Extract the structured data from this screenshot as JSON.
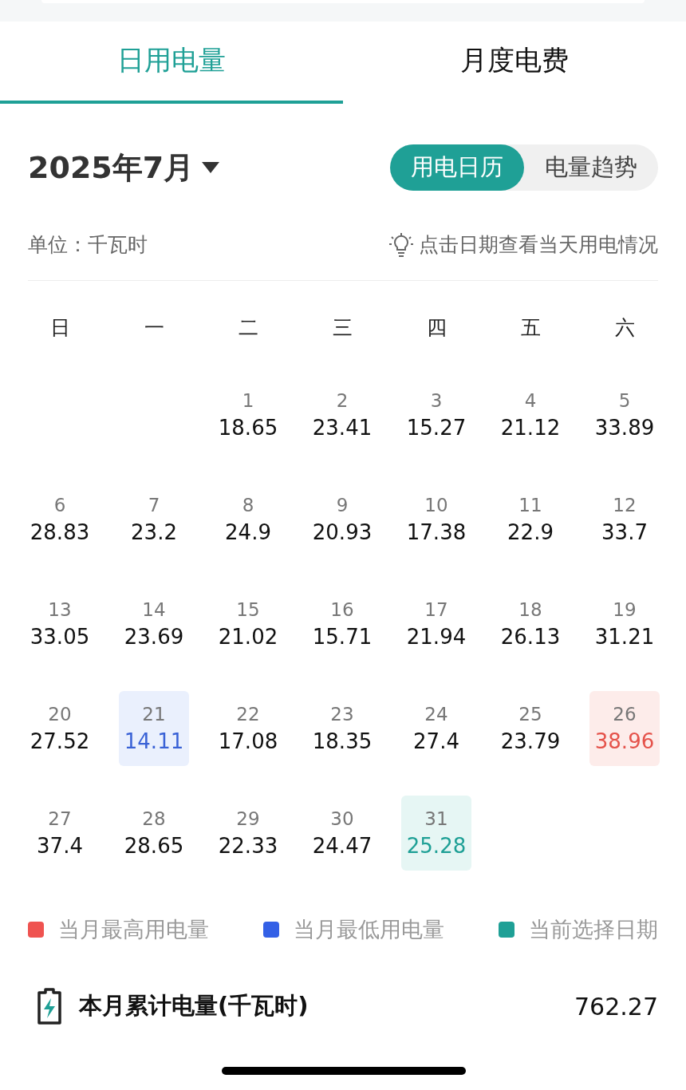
{
  "tabs": [
    {
      "label": "日用电量",
      "selected": true
    },
    {
      "label": "月度电费",
      "selected": false
    }
  ],
  "month_picker": {
    "label": "2025年7月"
  },
  "view_toggle": [
    {
      "label": "用电日历",
      "selected": true
    },
    {
      "label": "电量趋势",
      "selected": false
    }
  ],
  "unit": "单位：千瓦时",
  "hint": "点击日期查看当天用电情况",
  "weekdays": [
    "日",
    "一",
    "二",
    "三",
    "四",
    "五",
    "六"
  ],
  "weeks": [
    {
      "days": [
        {
          "date": "1",
          "value": "18.65",
          "kind": "normal"
        },
        {
          "date": "2",
          "value": "23.41",
          "kind": "normal"
        },
        {
          "date": "3",
          "value": "15.27",
          "kind": "normal"
        },
        {
          "date": "4",
          "value": "21.12",
          "kind": "normal"
        },
        {
          "date": "5",
          "value": "33.89",
          "kind": "normal"
        }
      ]
    },
    {
      "days": [
        {
          "date": "6",
          "value": "28.83",
          "kind": "normal"
        },
        {
          "date": "7",
          "value": "23.2",
          "kind": "normal"
        },
        {
          "date": "8",
          "value": "24.9",
          "kind": "normal"
        },
        {
          "date": "9",
          "value": "20.93",
          "kind": "normal"
        },
        {
          "date": "10",
          "value": "17.38",
          "kind": "normal"
        },
        {
          "date": "11",
          "value": "22.9",
          "kind": "normal"
        },
        {
          "date": "12",
          "value": "33.7",
          "kind": "normal"
        }
      ]
    },
    {
      "days": [
        {
          "date": "13",
          "value": "33.05",
          "kind": "normal"
        },
        {
          "date": "14",
          "value": "23.69",
          "kind": "normal"
        },
        {
          "date": "15",
          "value": "21.02",
          "kind": "normal"
        },
        {
          "date": "16",
          "value": "15.71",
          "kind": "normal"
        },
        {
          "date": "17",
          "value": "21.94",
          "kind": "normal"
        },
        {
          "date": "18",
          "value": "26.13",
          "kind": "normal"
        },
        {
          "date": "19",
          "value": "31.21",
          "kind": "normal"
        }
      ]
    },
    {
      "days": [
        {
          "date": "20",
          "value": "27.52",
          "kind": "normal"
        },
        {
          "date": "21",
          "value": "14.11",
          "kind": "lowest"
        },
        {
          "date": "22",
          "value": "17.08",
          "kind": "normal"
        },
        {
          "date": "23",
          "value": "18.35",
          "kind": "normal"
        },
        {
          "date": "24",
          "value": "27.4",
          "kind": "normal"
        },
        {
          "date": "25",
          "value": "23.79",
          "kind": "normal"
        },
        {
          "date": "26",
          "value": "38.96",
          "kind": "highest"
        }
      ]
    },
    {
      "days": [
        {
          "date": "27",
          "value": "37.4",
          "kind": "normal"
        },
        {
          "date": "28",
          "value": "28.65",
          "kind": "normal"
        },
        {
          "date": "29",
          "value": "22.33",
          "kind": "normal"
        },
        {
          "date": "30",
          "value": "24.47",
          "kind": "normal"
        },
        {
          "date": "31",
          "value": "25.28",
          "kind": "selected"
        }
      ]
    }
  ],
  "legend": [
    {
      "label": "当月最高用电量",
      "color": "#ef5350"
    },
    {
      "label": "当月最低用电量",
      "color": "#3360e6"
    },
    {
      "label": "当前选择日期",
      "color": "#1fa096"
    }
  ],
  "summary": {
    "label": "本月累计电量(千瓦时)",
    "value": "762.27"
  }
}
